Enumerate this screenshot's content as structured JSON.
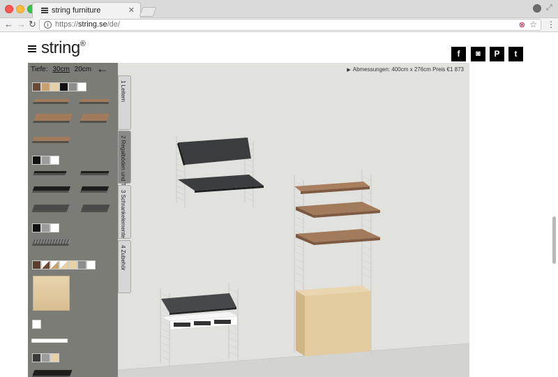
{
  "browser": {
    "tab_title": "string furniture",
    "tab_close": "✕",
    "url_scheme": "https://",
    "url_host": "string.se",
    "url_path": "/de/"
  },
  "site": {
    "logo": "string",
    "logo_mark": "®",
    "social": [
      "f",
      "◙",
      "P",
      "t"
    ]
  },
  "configurator": {
    "tiefe_label": "Tiefe:",
    "depth_options": [
      "30cm",
      "20cm"
    ],
    "depth_selected": "30cm",
    "dimensions": "Abmessungen: 400cm x 276cm   Preis €1 873",
    "tabs": [
      "1 Leitern",
      "2 Regalböden und Tisch",
      "3 Schrankelemente",
      "4 Zubehör"
    ],
    "active_tab": "2 Regalböden und Tisch"
  },
  "icons": {
    "back": "arrow-left-icon",
    "menu": "hamburger-icon",
    "info": "info-icon",
    "star": "star-icon"
  },
  "colors": {
    "sidebar": "#7b7c76",
    "canvas": "#e1e2de",
    "walnut": "#a27b5c",
    "oak": "#e4cfa6",
    "black": "#2e2f31"
  }
}
